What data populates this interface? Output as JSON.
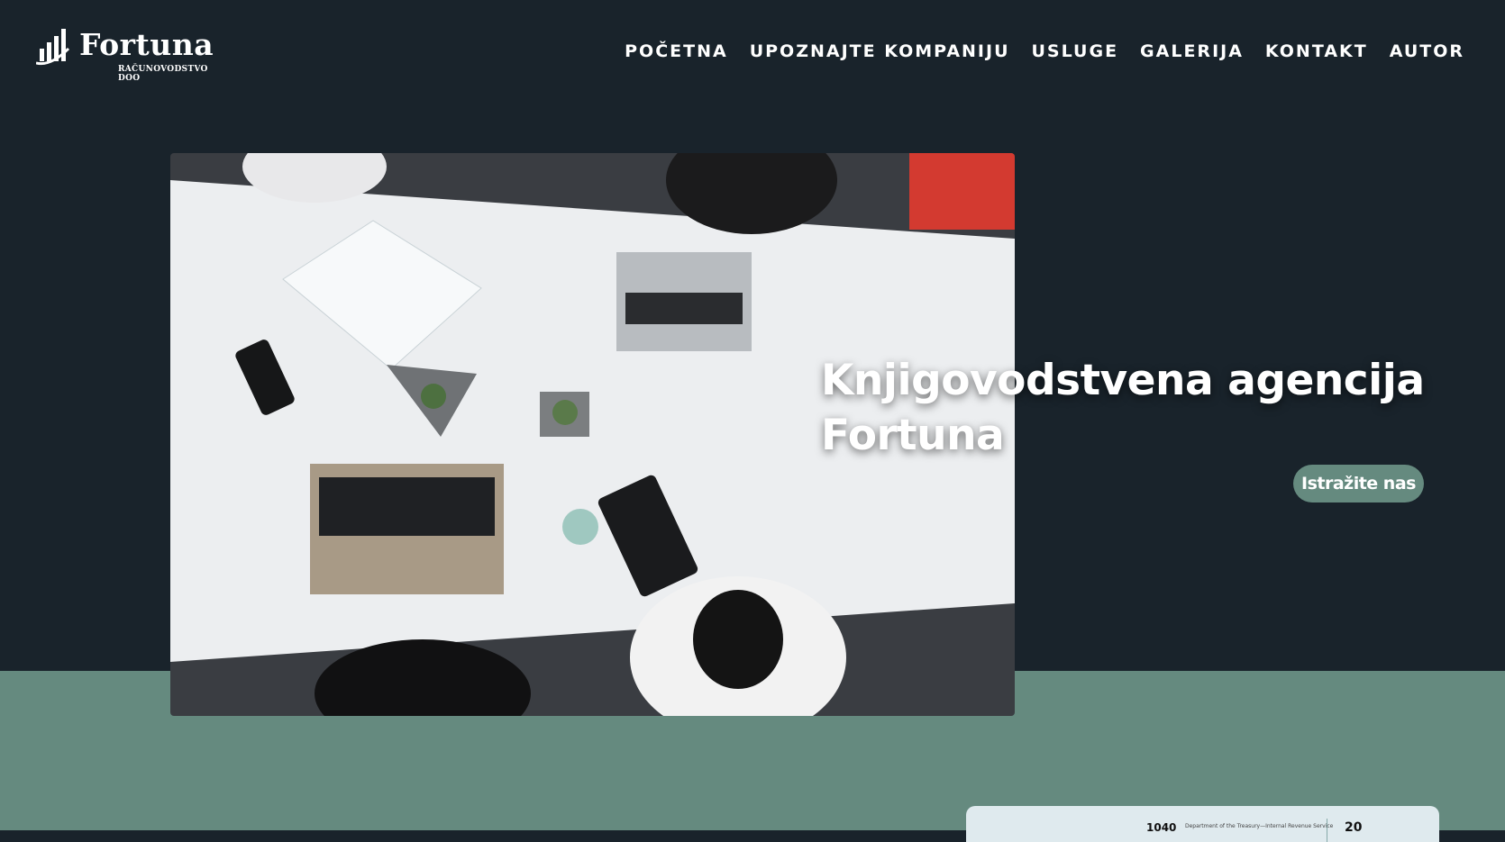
{
  "brand": {
    "name": "Fortuna",
    "tagline": "RAČUNOVODSTVO DOO"
  },
  "nav": {
    "items": [
      {
        "label": "POČETNA"
      },
      {
        "label": "UPOZNAJTE KOMPANIJU"
      },
      {
        "label": "USLUGE"
      },
      {
        "label": "GALERIJA"
      },
      {
        "label": "KONTAKT"
      },
      {
        "label": "AUTOR"
      }
    ]
  },
  "hero": {
    "title_line1": "Knjigovodstvena agencija",
    "title_line2": "Fortuna",
    "cta_label": "Istražite nas",
    "image_icon": "office-meeting-photo"
  },
  "preview_card": {
    "form_number": "1040",
    "form_text": "Department of the Treasury—Internal Revenue Service",
    "year_digits": "20"
  },
  "colors": {
    "background": "#19232b",
    "accent": "#658a7f",
    "text": "#ffffff"
  }
}
